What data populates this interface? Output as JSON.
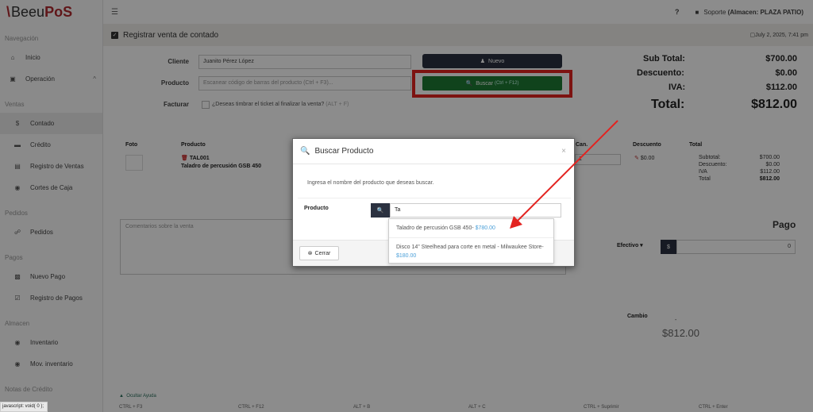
{
  "brand": {
    "mark": "\\",
    "name": "Beeu",
    "suffix": "PoS"
  },
  "sidebar": {
    "sections": [
      {
        "header": "Navegación",
        "items": [
          {
            "label": "Inicio",
            "icon": "home-icon"
          },
          {
            "label": "Operación",
            "icon": "briefcase-icon",
            "chevron": "^"
          }
        ]
      },
      {
        "header": "Ventas",
        "items": [
          {
            "label": "Contado",
            "icon": "dollar-icon"
          },
          {
            "label": "Crédito",
            "icon": "card-icon"
          },
          {
            "label": "Registro de Ventas",
            "icon": "list-icon"
          },
          {
            "label": "Cortes de Caja",
            "icon": "cube-icon"
          }
        ]
      },
      {
        "header": "Pedidos",
        "items": [
          {
            "label": "Pedidos",
            "icon": "cart-icon"
          }
        ]
      },
      {
        "header": "Pagos",
        "items": [
          {
            "label": "Nuevo Pago",
            "icon": "money-icon"
          },
          {
            "label": "Registro de Pagos",
            "icon": "checkbox-icon"
          }
        ]
      },
      {
        "header": "Almacen",
        "items": [
          {
            "label": "Inventario",
            "icon": "cubes-icon"
          },
          {
            "label": "Mov. inventario",
            "icon": "cubes-icon"
          }
        ]
      },
      {
        "header": "Notas de Crédito",
        "items": []
      }
    ]
  },
  "topbar": {
    "help": "?",
    "user_label": "Soporte",
    "store": "(Almacen: PLAZA PATIO)"
  },
  "page": {
    "title": "Registrar venta de contado",
    "date": "July 2, 2025, 7:41 pm"
  },
  "form": {
    "cliente_label": "Cliente",
    "cliente_value": "Juanito Pérez López",
    "producto_label": "Producto",
    "producto_placeholder": "Escanear código de barras del producto (Ctrl + F3)...",
    "facturar_label": "Facturar",
    "facturar_text": "¿Deseas timbrar el ticket al finalizar la venta?",
    "facturar_shortcut": "(ALT + F)",
    "nuevo_label": "Nuevo",
    "buscar_label": "Buscar",
    "buscar_shortcut": "(Ctrl + F12)"
  },
  "totals": {
    "subtotal_label": "Sub Total:",
    "subtotal": "$700.00",
    "descuento_label": "Descuento:",
    "descuento": "$0.00",
    "iva_label": "IVA:",
    "iva": "$112.00",
    "total_label": "Total:",
    "total": "$812.00"
  },
  "table": {
    "headers": {
      "foto": "Foto",
      "producto": "Producto",
      "cant": "Can.",
      "descuento": "Descuento",
      "total": "Total"
    },
    "row": {
      "code": "TAL001",
      "name": "Taladro de percusión GSB 450",
      "qty": "1",
      "discount": "$0.00",
      "breakdown": [
        {
          "k": "Subtotal:",
          "v": "$700.00"
        },
        {
          "k": "Descuento:",
          "v": "$0.00"
        },
        {
          "k": "IVA",
          "v": "$112.00"
        },
        {
          "k": "Total",
          "v": "$812.00"
        }
      ]
    }
  },
  "comments_placeholder": "Comentarios sobre la venta",
  "payment": {
    "title": "Pago",
    "method": "Efectivo",
    "currency": "$",
    "amount": "0",
    "cambio_label": "Cambio",
    "cambio_dash": "-",
    "cambio_value": "$812.00"
  },
  "modal": {
    "title": "Buscar Producto",
    "close_x": "×",
    "instruction": "Ingresa el nombre del producto que deseas buscar.",
    "producto_label": "Producto",
    "search_value": "Ta",
    "close_label": "Cerrar",
    "results": [
      {
        "name": "Taladro de percusión GSB 450- ",
        "price": "$780.00"
      },
      {
        "name": "Disco 14\" Steelhead para corte en metal - Milwaukee Store- ",
        "price": "$180.00"
      }
    ]
  },
  "help": {
    "toggle": "Ocultar Ayuda"
  },
  "shortcuts": [
    "CTRL + F3",
    "CTRL + F12",
    "ALT + B",
    "ALT + C",
    "CTRL + Suprimir",
    "CTRL + Enter"
  ],
  "status_bar": "javascript: void( 0 );"
}
